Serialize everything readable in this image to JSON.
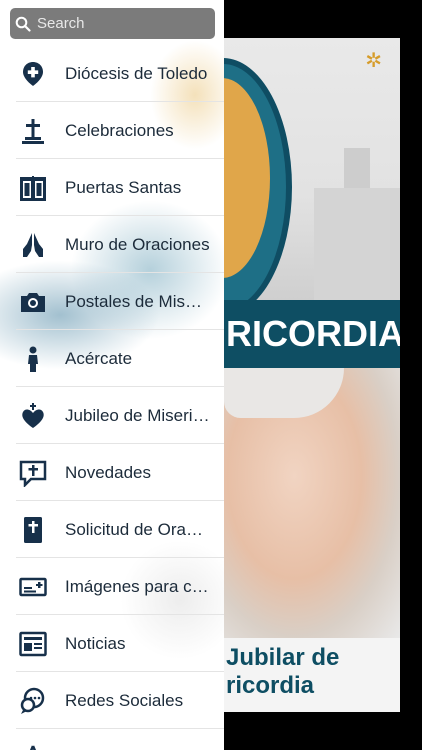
{
  "search": {
    "placeholder": "Search"
  },
  "menu": [
    {
      "label": "Diócesis de Toledo",
      "icon": "map-pin-plus-icon"
    },
    {
      "label": "Celebraciones",
      "icon": "cross-altar-icon"
    },
    {
      "label": "Puertas Santas",
      "icon": "holy-door-icon"
    },
    {
      "label": "Muro de Oraciones",
      "icon": "praying-hands-icon"
    },
    {
      "label": "Postales de Misericordia",
      "icon": "camera-icon"
    },
    {
      "label": "Acércate",
      "icon": "person-icon"
    },
    {
      "label": "Jubileo de Misericordia",
      "icon": "sacred-heart-icon"
    },
    {
      "label": "Novedades",
      "icon": "chat-cross-icon"
    },
    {
      "label": "Solicitud de Oración",
      "icon": "bible-icon"
    },
    {
      "label": "Imágenes para compartir",
      "icon": "image-card-icon"
    },
    {
      "label": "Noticias",
      "icon": "newspaper-icon"
    },
    {
      "label": "Redes Sociales",
      "icon": "social-bubbles-icon"
    }
  ],
  "background": {
    "banner_text": "RICORDIA",
    "footer_line1": "Jubilar de",
    "footer_line2": "ricordia",
    "star_glyph": "✲"
  },
  "colors": {
    "accent": "#0e4e63",
    "icon": "#17304a",
    "drawer_bg": "#ffffff"
  }
}
